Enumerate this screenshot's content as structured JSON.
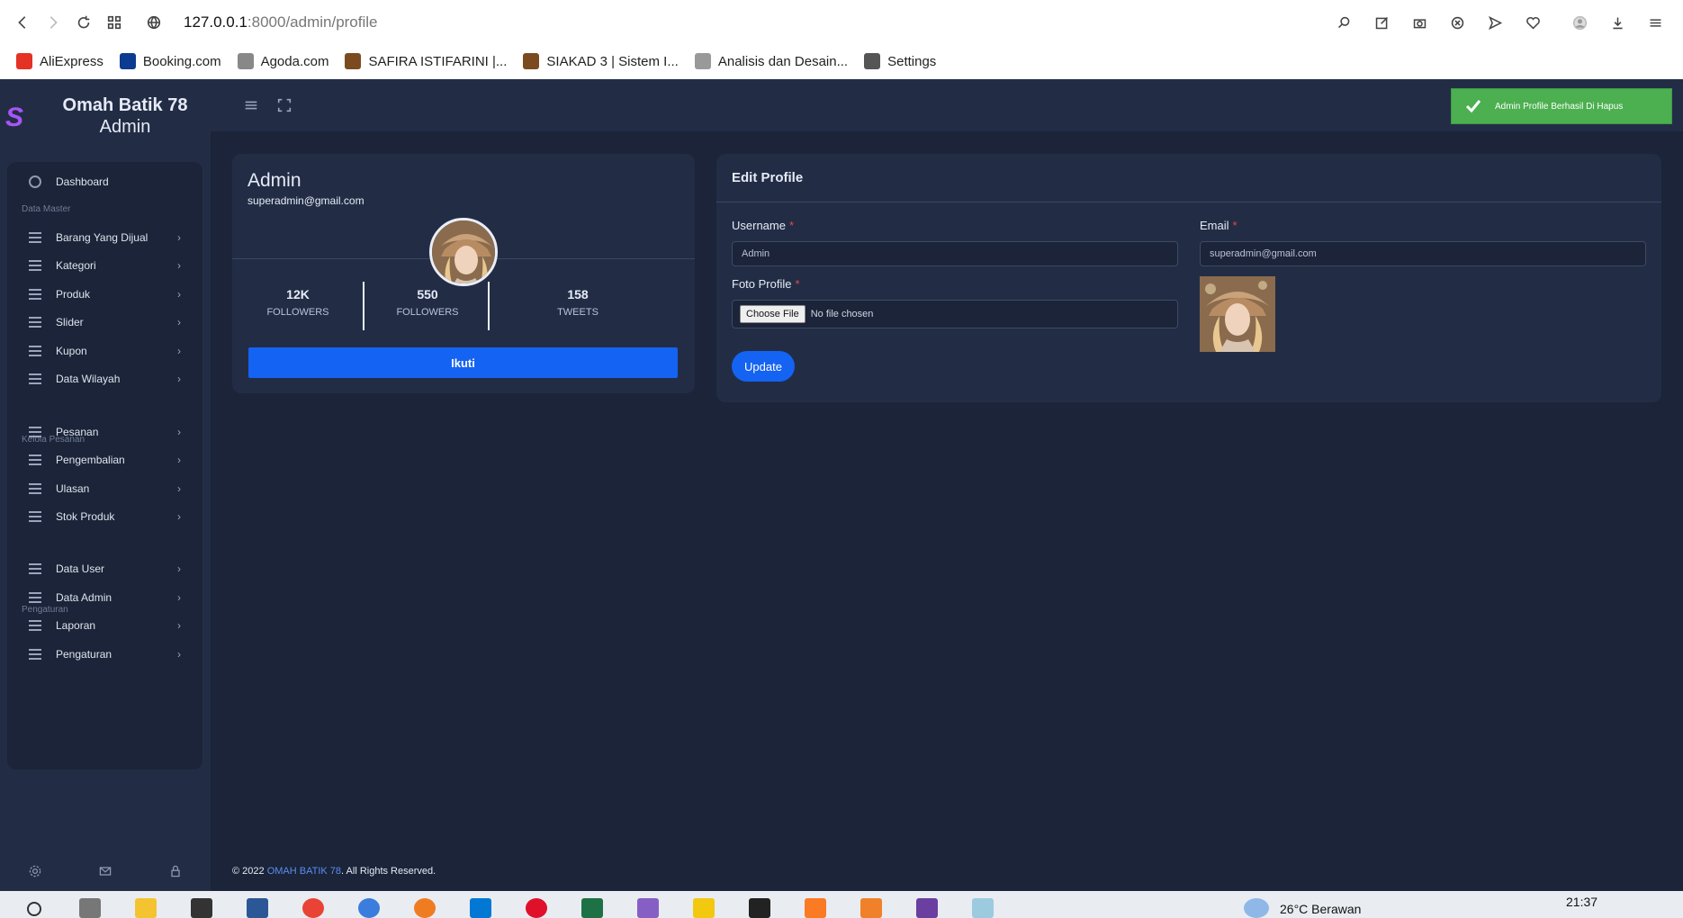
{
  "browser": {
    "url_host": "127.0.0.1",
    "url_path": ":8000/admin/profile",
    "bookmarks": [
      {
        "label": "AliExpress",
        "color": "#e43225"
      },
      {
        "label": "Booking.com",
        "color": "#0c3b91"
      },
      {
        "label": "Agoda.com",
        "color": "#888888"
      },
      {
        "label": "SAFIRA ISTIFARINI |...",
        "color": "#7b4a1e"
      },
      {
        "label": "SIAKAD 3 | Sistem I...",
        "color": "#7b4a1e"
      },
      {
        "label": "Analisis dan Desain...",
        "color": "#999999"
      },
      {
        "label": "Settings",
        "color": "#555555"
      }
    ]
  },
  "sidebar": {
    "brand_title": "Omah Batik 78",
    "brand_sub": "Admin",
    "brand_logo": "S",
    "dashboard": "Dashboard",
    "sections": {
      "master": "Data Master",
      "pesanan": "Kelola Pesanan",
      "pengaturan": "Pengaturan"
    },
    "items": [
      {
        "label": "Barang Yang Dijual"
      },
      {
        "label": "Kategori"
      },
      {
        "label": "Produk"
      },
      {
        "label": "Slider"
      },
      {
        "label": "Kupon"
      },
      {
        "label": "Data Wilayah"
      },
      {
        "label": "Pesanan"
      },
      {
        "label": "Pengembalian"
      },
      {
        "label": "Ulasan"
      },
      {
        "label": "Stok Produk"
      },
      {
        "label": "Data User"
      },
      {
        "label": "Data Admin"
      },
      {
        "label": "Laporan"
      },
      {
        "label": "Pengaturan"
      }
    ]
  },
  "toast": {
    "message": "Admin Profile Berhasil Di Hapus",
    "color": "#4caf50"
  },
  "profile": {
    "name": "Admin",
    "email": "superadmin@gmail.com",
    "stats": [
      {
        "num": "12K",
        "label": "FOLLOWERS"
      },
      {
        "num": "550",
        "label": "FOLLOWERS"
      },
      {
        "num": "158",
        "label": "TWEETS"
      }
    ],
    "follow_label": "Ikuti"
  },
  "edit": {
    "title": "Edit Profile",
    "username_label": "Username",
    "username_value": "Admin",
    "email_label": "Email",
    "email_value": "superadmin@gmail.com",
    "photo_label": "Foto Profile",
    "file_button": "Choose File",
    "file_status": "No file chosen",
    "update_label": "Update",
    "required_mark": "*"
  },
  "footer": {
    "prefix": "© 2022",
    "brand": "OMAH BATIK 78",
    "suffix": ". All Rights Reserved."
  },
  "taskbar": {
    "weather": "26°C  Berawan",
    "time": "21:37"
  },
  "colors": {
    "accent": "#1463f3",
    "page_bg": "#1b2438",
    "card_bg": "#222d45"
  }
}
